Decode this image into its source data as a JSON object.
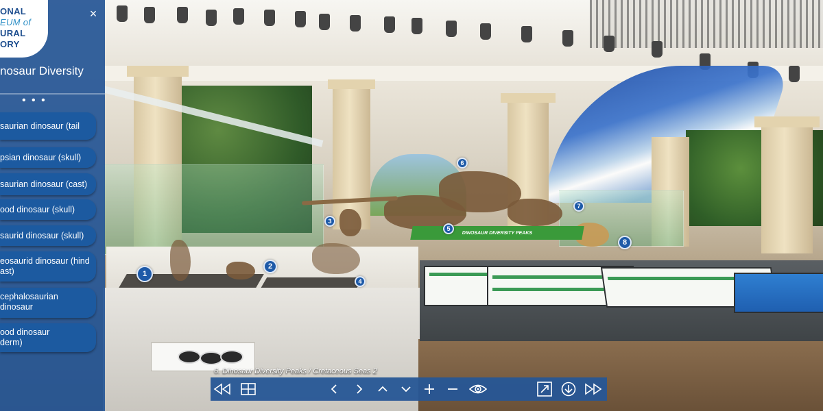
{
  "logo": {
    "lines": [
      "ONAL",
      "EUM of",
      "URAL",
      "ORY"
    ]
  },
  "sidebar": {
    "close_label": "×",
    "title": "nosaur Diversity",
    "more_label": "• • •",
    "items": [
      {
        "label": "saurian dinosaur (tail"
      },
      {
        "label": "psian dinosaur (skull)"
      },
      {
        "label": "saurian dinosaur (cast)"
      },
      {
        "label": "ood dinosaur (skull)"
      },
      {
        "label": "saurid dinosaur (skull)"
      },
      {
        "label": "eosaurid dinosaur (hind\nast)"
      },
      {
        "label": "cephalosaurian dinosaur"
      },
      {
        "label": "ood dinosaur\nderm)"
      }
    ]
  },
  "scene": {
    "sign_text": "DINOSAUR DIVERSITY PEAKS",
    "markers": [
      "1",
      "2",
      "3",
      "4",
      "5",
      "6",
      "7",
      "8"
    ]
  },
  "viewer": {
    "caption": "6. Dinosaur Diversity Peaks / Cretaceous Seas 2",
    "toolbar": {
      "buttons": [
        {
          "name": "rewind-icon",
          "label": "⏪"
        },
        {
          "name": "grid-icon",
          "label": "grid"
        },
        {
          "name": "pan-left-icon",
          "label": "‹"
        },
        {
          "name": "pan-right-icon",
          "label": "›"
        },
        {
          "name": "pan-up-icon",
          "label": "^"
        },
        {
          "name": "pan-down-icon",
          "label": "v"
        },
        {
          "name": "zoom-in-icon",
          "label": "+"
        },
        {
          "name": "zoom-out-icon",
          "label": "−"
        },
        {
          "name": "eye-icon",
          "label": "view"
        },
        {
          "name": "fullscreen-icon",
          "label": "fullscreen"
        },
        {
          "name": "download-icon",
          "label": "download"
        },
        {
          "name": "fast-forward-icon",
          "label": "⏩"
        }
      ]
    }
  },
  "colors": {
    "panel": "#265696",
    "button": "#1c5aa0",
    "marker": "#1e5aa8",
    "accent_green": "#3a9a3a"
  }
}
